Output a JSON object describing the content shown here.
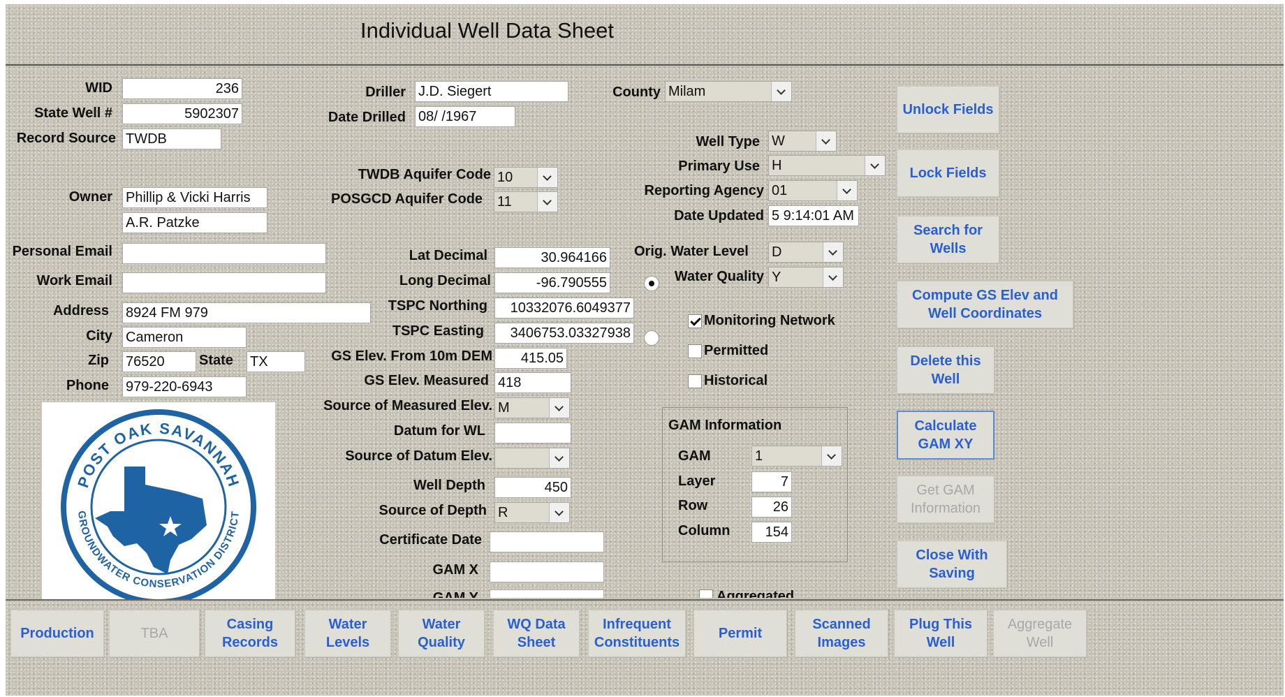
{
  "title": "Individual Well Data Sheet",
  "well": {
    "wid_label": "WID",
    "wid": "236",
    "state_well_label": "State Well #",
    "state_well": "5902307",
    "record_source_label": "Record Source",
    "record_source": "TWDB",
    "owner_label": "Owner",
    "owner1": "Phillip & Vicki Harris",
    "owner2": "A.R. Patzke",
    "personal_email_label": "Personal Email",
    "personal_email": "",
    "work_email_label": "Work Email",
    "work_email": "",
    "address_label": "Address",
    "address": "8924 FM 979",
    "city_label": "City",
    "city": "Cameron",
    "zip_label": "Zip",
    "zip": "76520",
    "state_label": "State",
    "state": "TX",
    "phone_label": "Phone",
    "phone": "979-220-6943"
  },
  "drill": {
    "driller_label": "Driller",
    "driller": "J.D. Siegert",
    "date_drilled_label": "Date Drilled",
    "date_drilled": "08/ /1967",
    "twdb_aquifer_label": "TWDB Aquifer Code",
    "twdb_aquifer": "10",
    "posgcd_aquifer_label": "POSGCD Aquifer Code",
    "posgcd_aquifer": "11",
    "lat_label": "Lat Decimal",
    "lat": "30.964166",
    "long_label": "Long Decimal",
    "long": "-96.790555",
    "tspc_northing_label": "TSPC Northing",
    "tspc_northing": "10332076.6049377",
    "tspc_easting_label": "TSPC Easting",
    "tspc_easting": "3406753.03327938",
    "gs_dem_label": "GS Elev. From 10m DEM",
    "gs_dem": "415.05",
    "gs_measured_label": "GS Elev. Measured",
    "gs_measured": "418",
    "source_measured_label": "Source of Measured Elev.",
    "source_measured": "M",
    "datum_wl_label": "Datum for WL",
    "datum_wl": "",
    "source_datum_label": "Source of Datum Elev.",
    "source_datum": "",
    "well_depth_label": "Well Depth",
    "well_depth": "450",
    "source_depth_label": "Source of Depth",
    "source_depth": "R",
    "certificate_date_label": "Certificate Date",
    "certificate_date": "",
    "gam_x_label": "GAM X",
    "gam_x": "",
    "gam_y_label": "GAM Y",
    "gam_y": ""
  },
  "status": {
    "county_label": "County",
    "county": "Milam",
    "well_type_label": "Well Type",
    "well_type": "W",
    "primary_use_label": "Primary Use",
    "primary_use": "H",
    "reporting_agency_label": "Reporting Agency",
    "reporting_agency": "01",
    "date_updated_label": "Date Updated",
    "date_updated": "5 9:14:01 AM",
    "orig_water_level_label": "Orig. Water Level",
    "orig_water_level": "D",
    "water_quality_label": "Water Quality",
    "water_quality": "Y",
    "monitoring_network_label": "Monitoring Network",
    "monitoring_network": true,
    "permitted_label": "Permitted",
    "permitted": false,
    "historical_label": "Historical",
    "historical": false,
    "aggregated_label": "Aggregated",
    "aggregated": false
  },
  "gam": {
    "title": "GAM Information",
    "gam_label": "GAM",
    "gam": "1",
    "layer_label": "Layer",
    "layer": "7",
    "row_label": "Row",
    "row": "26",
    "column_label": "Column",
    "column": "154"
  },
  "actions": {
    "unlock": "Unlock Fields",
    "lock": "Lock Fields",
    "search": "Search for Wells",
    "compute": "Compute GS Elev and Well Coordinates",
    "delete": "Delete this Well",
    "calculate_gam": "Calculate GAM XY",
    "get_gam": "Get GAM Information",
    "close": "Close With Saving"
  },
  "tabs": [
    {
      "label": "Production",
      "enabled": true
    },
    {
      "label": "TBA",
      "enabled": false
    },
    {
      "label": "Casing Records",
      "enabled": true
    },
    {
      "label": "Water Levels",
      "enabled": true
    },
    {
      "label": "Water Quality",
      "enabled": true
    },
    {
      "label": "WQ Data Sheet",
      "enabled": true
    },
    {
      "label": "Infrequent Constituents",
      "enabled": true
    },
    {
      "label": "Permit",
      "enabled": true
    },
    {
      "label": "Scanned Images",
      "enabled": true
    },
    {
      "label": "Plug This Well",
      "enabled": true
    },
    {
      "label": "Aggregate Well",
      "enabled": false
    }
  ],
  "logo": {
    "text_top": "POST OAK SAVANNAH",
    "text_bottom": "GROUNDWATER CONSERVATION DISTRICT"
  },
  "colors": {
    "accent_button_text": "#2a5fd0",
    "disabled_text": "#a8a8a8",
    "logo_blue": "#1e63a3",
    "form_background": "#c6c3b6"
  }
}
